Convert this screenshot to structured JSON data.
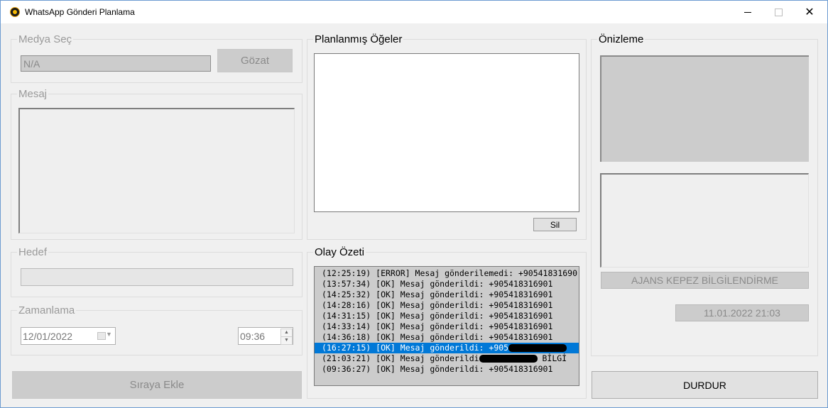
{
  "window": {
    "title": "WhatsApp Gönderi Planlama"
  },
  "media": {
    "legend": "Medya Seç",
    "path_value": "N/A",
    "browse_label": "Gözat"
  },
  "message": {
    "legend": "Mesaj"
  },
  "target": {
    "legend": "Hedef",
    "value": ""
  },
  "schedule": {
    "legend": "Zamanlama",
    "date_value": "12/01/2022",
    "time_value": "09:36"
  },
  "add_button_label": "Sıraya Ekle",
  "scheduled": {
    "legend": "Planlanmış Öğeler",
    "delete_label": "Sil"
  },
  "events": {
    "legend": "Olay Özeti",
    "rows": [
      {
        "text": "(12:25:19) [ERROR] Mesaj gönderilemedi: +90541831690"
      },
      {
        "text": "(13:57:34) [OK] Mesaj gönderildi: +905418316901"
      },
      {
        "text": "(14:25:32) [OK] Mesaj gönderildi: +905418316901"
      },
      {
        "text": "(14:28:16) [OK] Mesaj gönderildi: +905418316901"
      },
      {
        "text": "(14:31:15) [OK] Mesaj gönderildi: +905418316901"
      },
      {
        "text": "(14:33:14) [OK] Mesaj gönderildi: +905418316901"
      },
      {
        "text": "(14:36:18) [OK] Mesaj gönderildi: +905418316901"
      },
      {
        "text": "(16:27:15) [OK] Mesaj gönderildi: +905",
        "redacted": true,
        "selected": true
      },
      {
        "text": "(21:03:21) [OK] Mesaj gönderildi",
        "redacted": true,
        "suffix": " BİLGİ"
      },
      {
        "text": "(09:36:27) [OK] Mesaj gönderildi: +905418316901"
      }
    ]
  },
  "preview": {
    "legend": "Önizleme",
    "caption": "AJANS KEPEZ BİLGİLENDİRME",
    "datetime": "11.01.2022 21:03"
  },
  "stop_button_label": "DURDUR"
}
